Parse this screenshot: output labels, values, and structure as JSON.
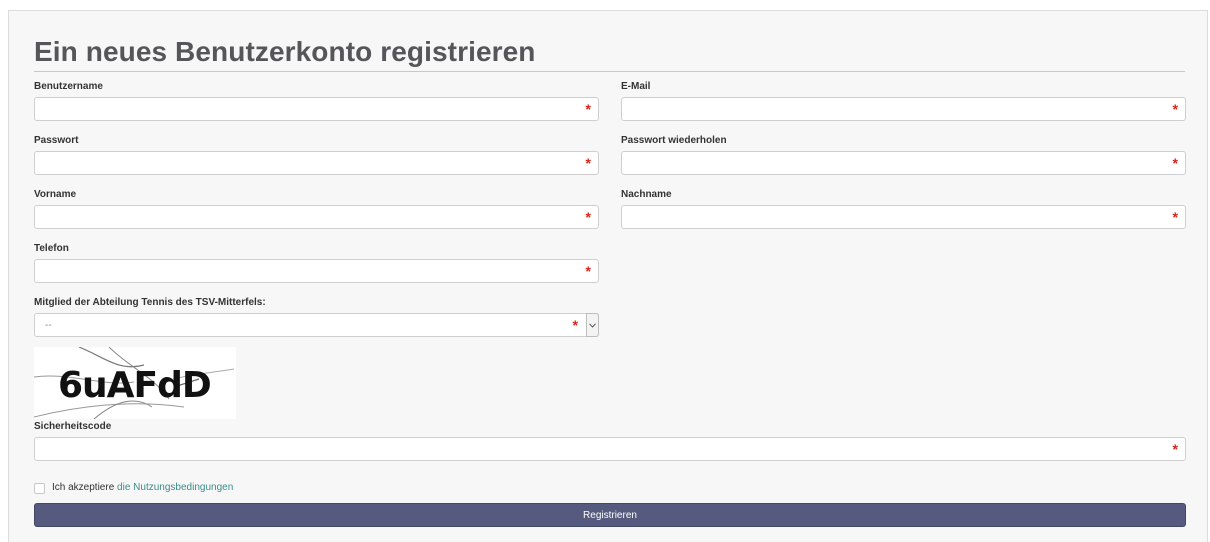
{
  "form": {
    "title": "Ein neues Benutzerkonto registrieren",
    "required_marker": "*",
    "fields": {
      "username": {
        "label": "Benutzername",
        "value": ""
      },
      "email": {
        "label": "E-Mail",
        "value": ""
      },
      "password": {
        "label": "Passwort",
        "value": ""
      },
      "password_repeat": {
        "label": "Passwort wiederholen",
        "value": ""
      },
      "first_name": {
        "label": "Vorname",
        "value": ""
      },
      "last_name": {
        "label": "Nachname",
        "value": ""
      },
      "phone": {
        "label": "Telefon",
        "value": ""
      },
      "membership": {
        "label": "Mitglied der Abteilung Tennis des TSV-Mitterfels:",
        "selected": "--"
      },
      "security_code": {
        "label": "Sicherheitscode",
        "value": ""
      }
    },
    "captcha": {
      "text": "6uAFdD"
    },
    "terms": {
      "prefix": "Ich akzeptiere",
      "link_text": "die Nutzungsbedingungen",
      "checked": false
    },
    "submit_label": "Registrieren"
  },
  "colors": {
    "required": "#d9241b",
    "link": "#3a8c8c",
    "submit_bg": "#555a7e",
    "title": "#55555a"
  },
  "icons": {
    "required": "asterisk-icon",
    "select": "chevron-down-icon"
  }
}
